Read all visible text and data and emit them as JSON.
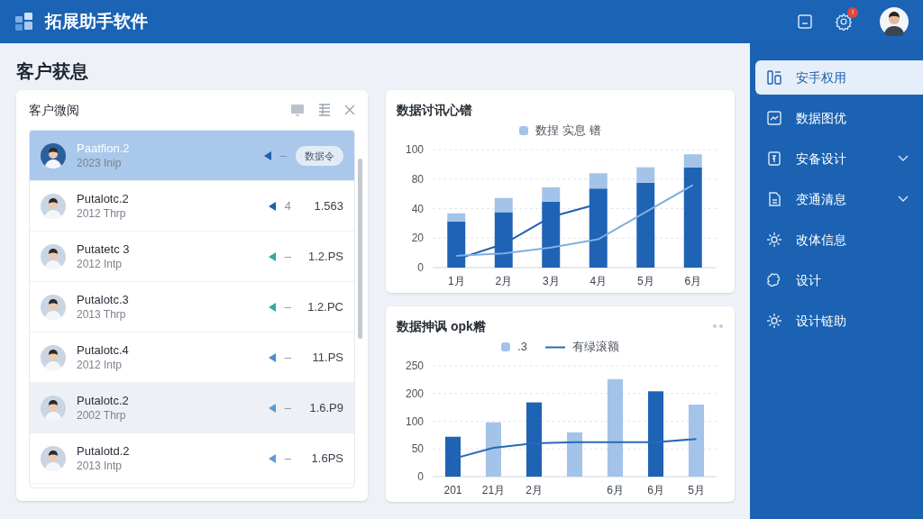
{
  "header": {
    "app_title": "拓展助手软件",
    "notification_badge": "!"
  },
  "page_title": "客户获息",
  "customer_panel": {
    "title": "客户微阅",
    "rows": [
      {
        "name": "Paatfion.2",
        "sub": "2023 Inip",
        "dash": "–",
        "badge": "数据令",
        "color": "#1f5fae",
        "selected": true,
        "hovered": false
      },
      {
        "name": "Putalotc.2",
        "sub": "2012 Thrp",
        "dash": "4",
        "value": "1.563",
        "color": "#1f5fae",
        "selected": false,
        "hovered": false
      },
      {
        "name": "Putatetc 3",
        "sub": "2012 Intp",
        "dash": "–",
        "value": "1.2.PS",
        "color": "#3aa8a0",
        "selected": false,
        "hovered": false
      },
      {
        "name": "Putalotc.3",
        "sub": "2013 Thrp",
        "dash": "–",
        "value": "1.2.PC",
        "color": "#3aa8a0",
        "selected": false,
        "hovered": false
      },
      {
        "name": "Putalotc.4",
        "sub": "2012 Intp",
        "dash": "–",
        "value": "11.PS",
        "color": "#4a8fd4",
        "selected": false,
        "hovered": false
      },
      {
        "name": "Putalotc.2",
        "sub": "2002 Thrp",
        "dash": "–",
        "value": "1.6.P9",
        "color": "#5b9bd5",
        "selected": false,
        "hovered": true
      },
      {
        "name": "Putalotd.2",
        "sub": "2013 Intp",
        "dash": "–",
        "value": "1.6PS",
        "color": "#5b9bd5",
        "selected": false,
        "hovered": false
      }
    ]
  },
  "charts": [
    {
      "title": "数据讨讯心镨",
      "legend": [
        {
          "label": "数捏 实息 镨",
          "kind": "swatch",
          "color": "#a3c4e8"
        }
      ],
      "y_labels": [
        "100",
        "80",
        "40",
        "20",
        "0"
      ],
      "x_labels": [
        "1月",
        "2月",
        "3月",
        "4月",
        "5月",
        "6月"
      ]
    },
    {
      "title": "数据抻讽 opk糌",
      "legend": [
        {
          "label": ".3",
          "kind": "swatch",
          "color": "#a3c4e8"
        },
        {
          "label": "有绿滚额",
          "kind": "line",
          "color": "#2a68b8"
        }
      ],
      "y_labels": [
        "250",
        "200",
        "100",
        "50",
        "0"
      ],
      "x_labels": [
        "201",
        "21月",
        "2月",
        "6月",
        "6月",
        "5月"
      ]
    }
  ],
  "sidebar": {
    "items": [
      {
        "label": "安手权用",
        "selected": true,
        "collapsible": false
      },
      {
        "label": "数据图优",
        "selected": false,
        "collapsible": false
      },
      {
        "label": "安备设计",
        "selected": false,
        "collapsible": true
      },
      {
        "label": "变通清息",
        "selected": false,
        "collapsible": true
      },
      {
        "label": "改体信息",
        "selected": false,
        "collapsible": false
      },
      {
        "label": "设计",
        "selected": false,
        "collapsible": false
      },
      {
        "label": "设计链助",
        "selected": false,
        "collapsible": false
      }
    ]
  }
}
